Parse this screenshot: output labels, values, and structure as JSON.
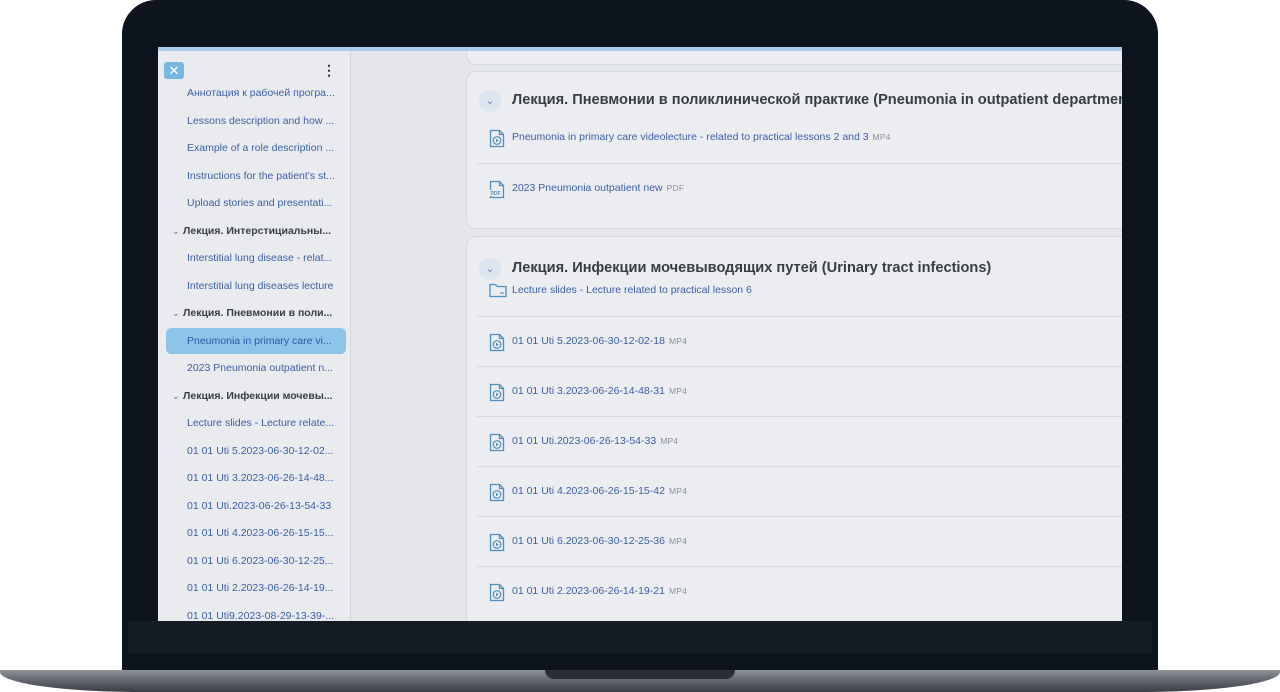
{
  "drawer": {
    "close_icon": "close-icon",
    "menu_icon": "kebab-menu-icon",
    "items": [
      {
        "label": "Аннотация к рабочей програ...",
        "kind": "activity",
        "active": false
      },
      {
        "label": "Lessons description and how ...",
        "kind": "activity",
        "active": false
      },
      {
        "label": "Example of a role description ...",
        "kind": "activity",
        "active": false
      },
      {
        "label": "Instructions for the patient's st...",
        "kind": "activity",
        "active": false
      },
      {
        "label": "Upload stories and presentati...",
        "kind": "activity",
        "active": false
      },
      {
        "label": "Лекция. Интерстициальны...",
        "kind": "section",
        "active": false
      },
      {
        "label": "Interstitial lung disease - relat...",
        "kind": "activity",
        "active": false
      },
      {
        "label": "Interstitial lung diseases lecture",
        "kind": "activity",
        "active": false
      },
      {
        "label": "Лекция. Пневмонии в поли...",
        "kind": "section",
        "active": false
      },
      {
        "label": "Pneumonia in primary care vi...",
        "kind": "activity",
        "active": true
      },
      {
        "label": "2023 Pneumonia outpatient n...",
        "kind": "activity",
        "active": false
      },
      {
        "label": "Лекция. Инфекции мочевы...",
        "kind": "section",
        "active": false
      },
      {
        "label": "Lecture slides - Lecture relate...",
        "kind": "activity",
        "active": false
      },
      {
        "label": "01 01 Uti 5.2023-06-30-12-02...",
        "kind": "activity",
        "active": false
      },
      {
        "label": "01 01 Uti 3.2023-06-26-14-48...",
        "kind": "activity",
        "active": false
      },
      {
        "label": "01 01 Uti.2023-06-26-13-54-33",
        "kind": "activity",
        "active": false
      },
      {
        "label": "01 01 Uti 4.2023-06-26-15-15...",
        "kind": "activity",
        "active": false
      },
      {
        "label": "01 01 Uti 6.2023-06-30-12-25...",
        "kind": "activity",
        "active": false
      },
      {
        "label": "01 01 Uti 2.2023-06-26-14-19...",
        "kind": "activity",
        "active": false
      },
      {
        "label": "01 01 Uti9.2023-08-29-13-39-...",
        "kind": "activity",
        "active": false
      }
    ]
  },
  "sections": [
    {
      "title": "Лекция. Пневмонии в поликлинической практике (Pneumonia in outpatient department)",
      "activities": [
        {
          "name": "Pneumonia in primary care videolecture - related to practical lessons 2 and 3",
          "type": "MP4",
          "icon": "video-file-icon"
        },
        {
          "name": "2023 Pneumonia outpatient new",
          "type": "PDF",
          "icon": "pdf-file-icon"
        }
      ]
    },
    {
      "title": "Лекция. Инфекции мочевыводящих путей (Urinary tract infections)",
      "activities": [
        {
          "name": "Lecture slides - Lecture related to practical lesson 6",
          "type": "",
          "icon": "folder-icon"
        },
        {
          "name": "01 01 Uti 5.2023-06-30-12-02-18",
          "type": "MP4",
          "icon": "video-file-icon"
        },
        {
          "name": "01 01 Uti 3.2023-06-26-14-48-31",
          "type": "MP4",
          "icon": "video-file-icon"
        },
        {
          "name": "01 01 Uti.2023-06-26-13-54-33",
          "type": "MP4",
          "icon": "video-file-icon"
        },
        {
          "name": "01 01 Uti 4.2023-06-26-15-15-42",
          "type": "MP4",
          "icon": "video-file-icon"
        },
        {
          "name": "01 01 Uti 6.2023-06-30-12-25-36",
          "type": "MP4",
          "icon": "video-file-icon"
        },
        {
          "name": "01 01 Uti 2.2023-06-26-14-19-21",
          "type": "MP4",
          "icon": "video-file-icon"
        }
      ]
    }
  ]
}
